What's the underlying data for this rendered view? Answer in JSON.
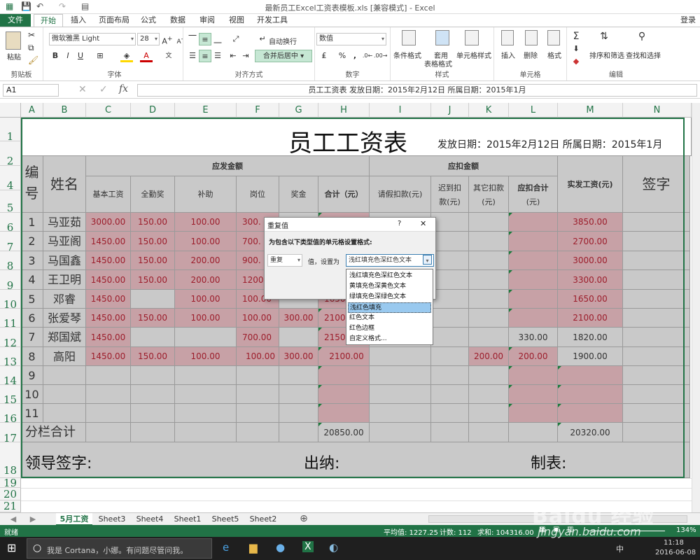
{
  "app": {
    "title": "最新员工Excel工资表模板.xls  [兼容模式] - Excel",
    "login": "登录"
  },
  "tabs": [
    "文件",
    "开始",
    "插入",
    "页面布局",
    "公式",
    "数据",
    "审阅",
    "视图",
    "开发工具"
  ],
  "ribbon": {
    "clipboard": {
      "paste": "粘贴",
      "label": "剪贴板"
    },
    "font": {
      "name": "微软雅黑 Light",
      "size": "28",
      "label": "字体"
    },
    "align": {
      "wrap": "自动换行",
      "merge": "合并后居中",
      "label": "对齐方式"
    },
    "number": {
      "format": "数值",
      "label": "数字"
    },
    "styles": {
      "cond": "条件格式",
      "table1": "套用",
      "table2": "表格格式",
      "cell": "单元格样式",
      "label": "样式"
    },
    "cells": {
      "insert": "插入",
      "delete": "删除",
      "format": "格式",
      "label": "单元格"
    },
    "edit": {
      "sort": "排序和筛选",
      "find": "查找和选择",
      "label": "编辑"
    }
  },
  "formula_bar": {
    "cell_ref": "A1",
    "content": "员工工资表    发放日期：2015年2月12日  所属日期：2015年1月"
  },
  "columns": [
    "A",
    "B",
    "C",
    "D",
    "E",
    "F",
    "G",
    "H",
    "I",
    "J",
    "K",
    "L",
    "M",
    "N"
  ],
  "row_numbers": [
    "1",
    "2",
    "4",
    "5",
    "6",
    "7",
    "8",
    "9",
    "10",
    "11",
    "12",
    "13",
    "14",
    "15",
    "16",
    "17",
    "18",
    "19",
    "20",
    "21"
  ],
  "sheet": {
    "title": "员工工资表",
    "subtitle": "发放日期：2015年2月12日 所属日期：2015年1月",
    "h_id": "编号",
    "h_name": "姓名",
    "h_payable": "应发金额",
    "h_deduct": "应扣金额",
    "h_base": "基本工资",
    "h_attend": "全勤奖",
    "h_subsidy": "补助",
    "h_post": "岗位",
    "h_bonus": "奖金",
    "h_total": "合计（元）",
    "h_leave": "请假扣款(元)",
    "h_late1": "迟到扣",
    "h_late2": "款(元)",
    "h_other1": "其它扣款",
    "h_other2": "(元)",
    "h_dtotal1": "应扣合计",
    "h_dtotal2": "(元)",
    "h_net": "实发工资(元)",
    "h_sign": "签字",
    "rows": [
      {
        "id": "1",
        "name": "马亚茹",
        "base": "3000.00",
        "attend": "150.00",
        "subsidy": "100.00",
        "post": "300.",
        "bonus": "",
        "total": "",
        "leave": "",
        "late": "",
        "other": "",
        "dtotal": "",
        "net": "3850.00"
      },
      {
        "id": "2",
        "name": "马亚阁",
        "base": "1450.00",
        "attend": "150.00",
        "subsidy": "100.00",
        "post": "700.",
        "bonus": "",
        "total": "",
        "leave": "",
        "late": "",
        "other": "",
        "dtotal": "",
        "net": "2700.00"
      },
      {
        "id": "3",
        "name": "马国鑫",
        "base": "1450.00",
        "attend": "150.00",
        "subsidy": "200.00",
        "post": "900.",
        "bonus": "",
        "total": "",
        "leave": "",
        "late": "",
        "other": "",
        "dtotal": "",
        "net": "3000.00"
      },
      {
        "id": "4",
        "name": "王卫明",
        "base": "1450.00",
        "attend": "150.00",
        "subsidy": "200.00",
        "post": "1200.",
        "bonus": "",
        "total": "",
        "leave": "",
        "late": "",
        "other": "",
        "dtotal": "",
        "net": "3300.00"
      },
      {
        "id": "5",
        "name": "邓睿",
        "base": "1450.00",
        "attend": "",
        "subsidy": "100.00",
        "post": "100.00",
        "bonus": "",
        "total": "1650",
        "leave": "",
        "late": "",
        "other": "",
        "dtotal": "",
        "net": "1650.00"
      },
      {
        "id": "6",
        "name": "张爱琴",
        "base": "1450.00",
        "attend": "150.00",
        "subsidy": "100.00",
        "post": "100.00",
        "bonus": "300.00",
        "total": "2100",
        "leave": "",
        "late": "",
        "other": "",
        "dtotal": "",
        "net": "2100.00"
      },
      {
        "id": "7",
        "name": "郑国斌",
        "base": "1450.00",
        "attend": "",
        "subsidy": "",
        "post": "700.00",
        "bonus": "",
        "total": "2150",
        "leave": "",
        "late": "",
        "other": "",
        "dtotal": "330.00",
        "net": "1820.00"
      },
      {
        "id": "8",
        "name": "高阳",
        "base": "1450.00",
        "attend": "150.00",
        "subsidy": "100.00",
        "post": "100.00",
        "bonus": "300.00",
        "total": "2100.00",
        "leave": "",
        "late": "",
        "other": "200.00",
        "dtotal": "200.00",
        "net": "1900.00"
      },
      {
        "id": "9",
        "name": "",
        "base": "",
        "attend": "",
        "subsidy": "",
        "post": "",
        "bonus": "",
        "total": "",
        "leave": "",
        "late": "",
        "other": "",
        "dtotal": "",
        "net": ""
      },
      {
        "id": "10",
        "name": "",
        "base": "",
        "attend": "",
        "subsidy": "",
        "post": "",
        "bonus": "",
        "total": "",
        "leave": "",
        "late": "",
        "other": "",
        "dtotal": "",
        "net": ""
      },
      {
        "id": "11",
        "name": "",
        "base": "",
        "attend": "",
        "subsidy": "",
        "post": "",
        "bonus": "",
        "total": "",
        "leave": "",
        "late": "",
        "other": "",
        "dtotal": "",
        "net": ""
      }
    ],
    "subtotal_label": "分栏合计",
    "subtotal_total": "20850.00",
    "subtotal_net": "20320.00",
    "sign_leader": "领导签字:",
    "sign_cashier": "出纳:",
    "sign_maker": "制表:"
  },
  "dialog": {
    "title": "重复值",
    "help": "?",
    "close": "✕",
    "prompt": "为包含以下类型值的单元格设置格式:",
    "type_value": "重复",
    "mid_text": "值，设置为",
    "format_value": "浅红填充色深红色文本",
    "options": [
      "浅红填充色深红色文本",
      "黄填充色深黄色文本",
      "绿填充色深绿色文本",
      "浅红色填充",
      "红色文本",
      "红色边框",
      "自定义格式..."
    ],
    "highlighted": "浅红色填充"
  },
  "sheet_tabs": [
    "5月工资",
    "Sheet3",
    "Sheet4",
    "Sheet1",
    "Sheet5",
    "Sheet2"
  ],
  "status": {
    "ready": "就绪",
    "avg": "平均值: 1227.25",
    "count": "计数: 112",
    "sum": "求和: 104316.00",
    "zoom": "134%"
  },
  "taskbar": {
    "cortana": "我是 Cortana，小娜。有问题尽管问我。",
    "time": "11:18",
    "date": "2016-06-08",
    "ime": "中"
  },
  "watermark": "jingyan.baidu.com"
}
